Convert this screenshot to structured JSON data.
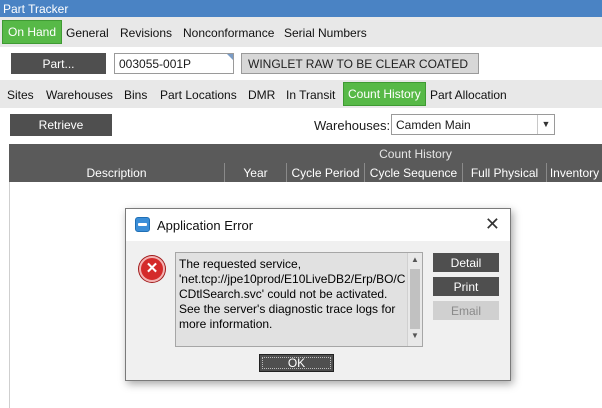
{
  "window": {
    "title": "Part Tracker"
  },
  "main_tabs": [
    {
      "label": "On Hand",
      "active": true
    },
    {
      "label": "General",
      "active": false
    },
    {
      "label": "Revisions",
      "active": false
    },
    {
      "label": "Nonconformance",
      "active": false
    },
    {
      "label": "Serial Numbers",
      "active": false
    }
  ],
  "part": {
    "button_label": "Part...",
    "number": "003055-001P",
    "description": "WINGLET RAW TO BE CLEAR COATED"
  },
  "sub_tabs": [
    {
      "label": "Sites",
      "active": false
    },
    {
      "label": "Warehouses",
      "active": false
    },
    {
      "label": "Bins",
      "active": false
    },
    {
      "label": "Part Locations",
      "active": false
    },
    {
      "label": "DMR",
      "active": false
    },
    {
      "label": "In Transit",
      "active": false
    },
    {
      "label": "Count History",
      "active": true
    },
    {
      "label": "Part Allocation",
      "active": false
    }
  ],
  "toolbar": {
    "retrieve_label": "Retrieve",
    "warehouses_label": "Warehouses:",
    "warehouse_value": "Camden Main"
  },
  "grid": {
    "group_header": "Count History",
    "columns": [
      "Description",
      "Year",
      "Cycle Period",
      "Cycle Sequence",
      "Full Physical",
      "Inventory"
    ]
  },
  "dialog": {
    "title": "Application Error",
    "message": "The requested service,\n'net.tcp://jpe10prod/E10LiveDB2/Erp/BO/C\nCDtlSearch.svc' could not be activated.\nSee the server's diagnostic trace logs for\nmore information.",
    "buttons": {
      "detail": "Detail",
      "print": "Print",
      "email": "Email",
      "ok": "OK"
    },
    "icons": {
      "title": "app-window-icon",
      "error": "error-x-icon",
      "close": "close-icon"
    }
  },
  "colors": {
    "accent_green": "#57b947",
    "title_blue": "#4a83c4",
    "dark_button": "#4f4f4f",
    "error_red": "#d42a2a"
  }
}
